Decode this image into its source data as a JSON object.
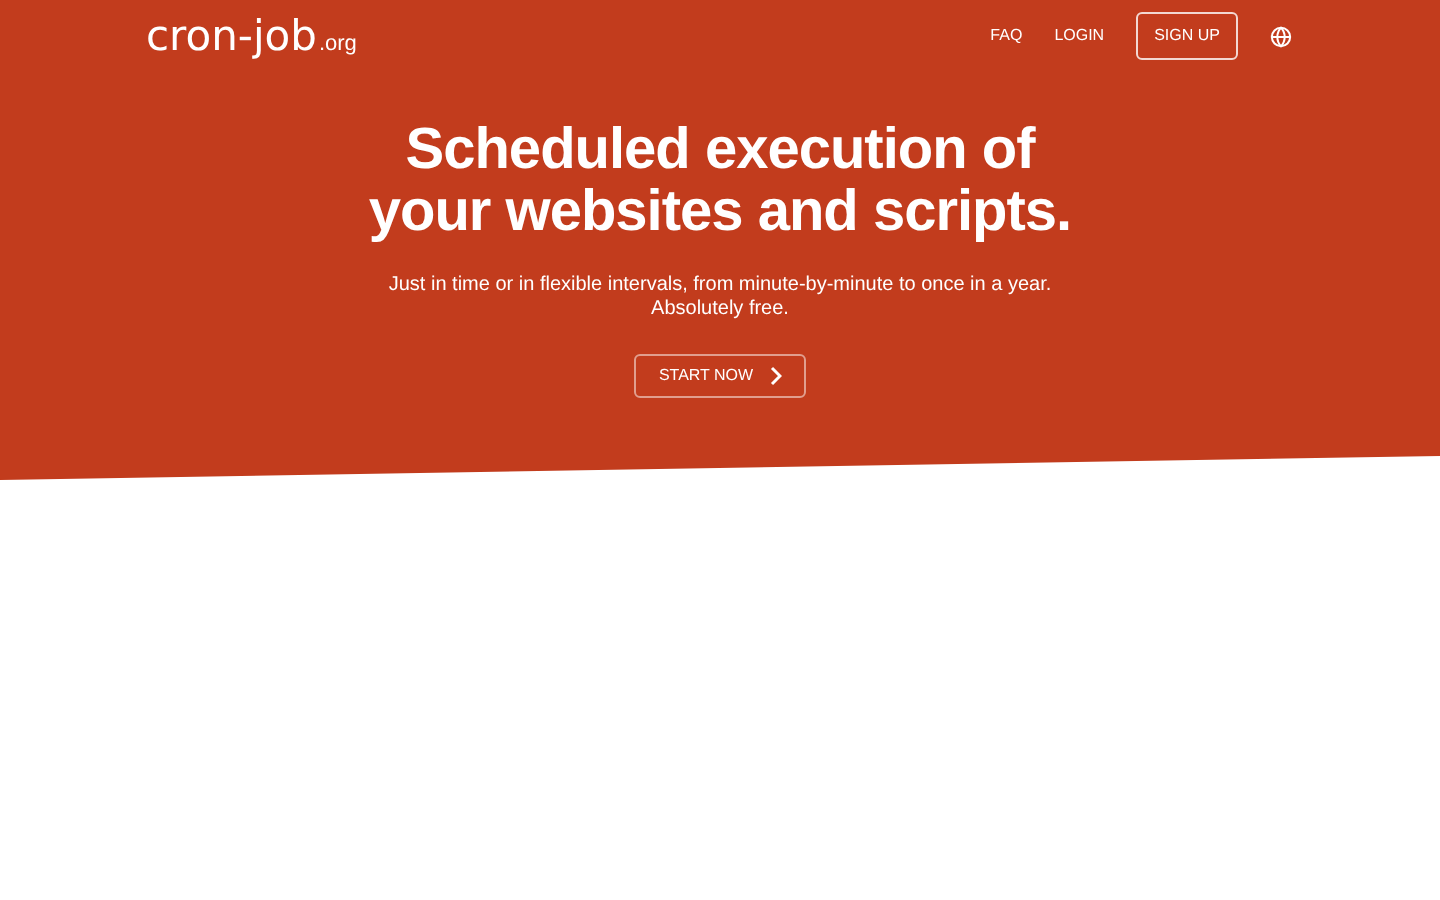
{
  "header": {
    "logo": {
      "name": "cron-job",
      "suffix": ".org"
    },
    "nav": [
      {
        "label": "FAQ",
        "kind": "link"
      },
      {
        "label": "LOGIN",
        "kind": "link"
      },
      {
        "label": "SIGN UP",
        "kind": "outlined"
      }
    ]
  },
  "hero": {
    "title": "Scheduled execution of your websites and scripts.",
    "subtitle": "Just in time or in flexible intervals, from minute-by-minute to once in a year.",
    "subtitle_2": "Absolutely free.",
    "cta": "START NOW"
  }
}
